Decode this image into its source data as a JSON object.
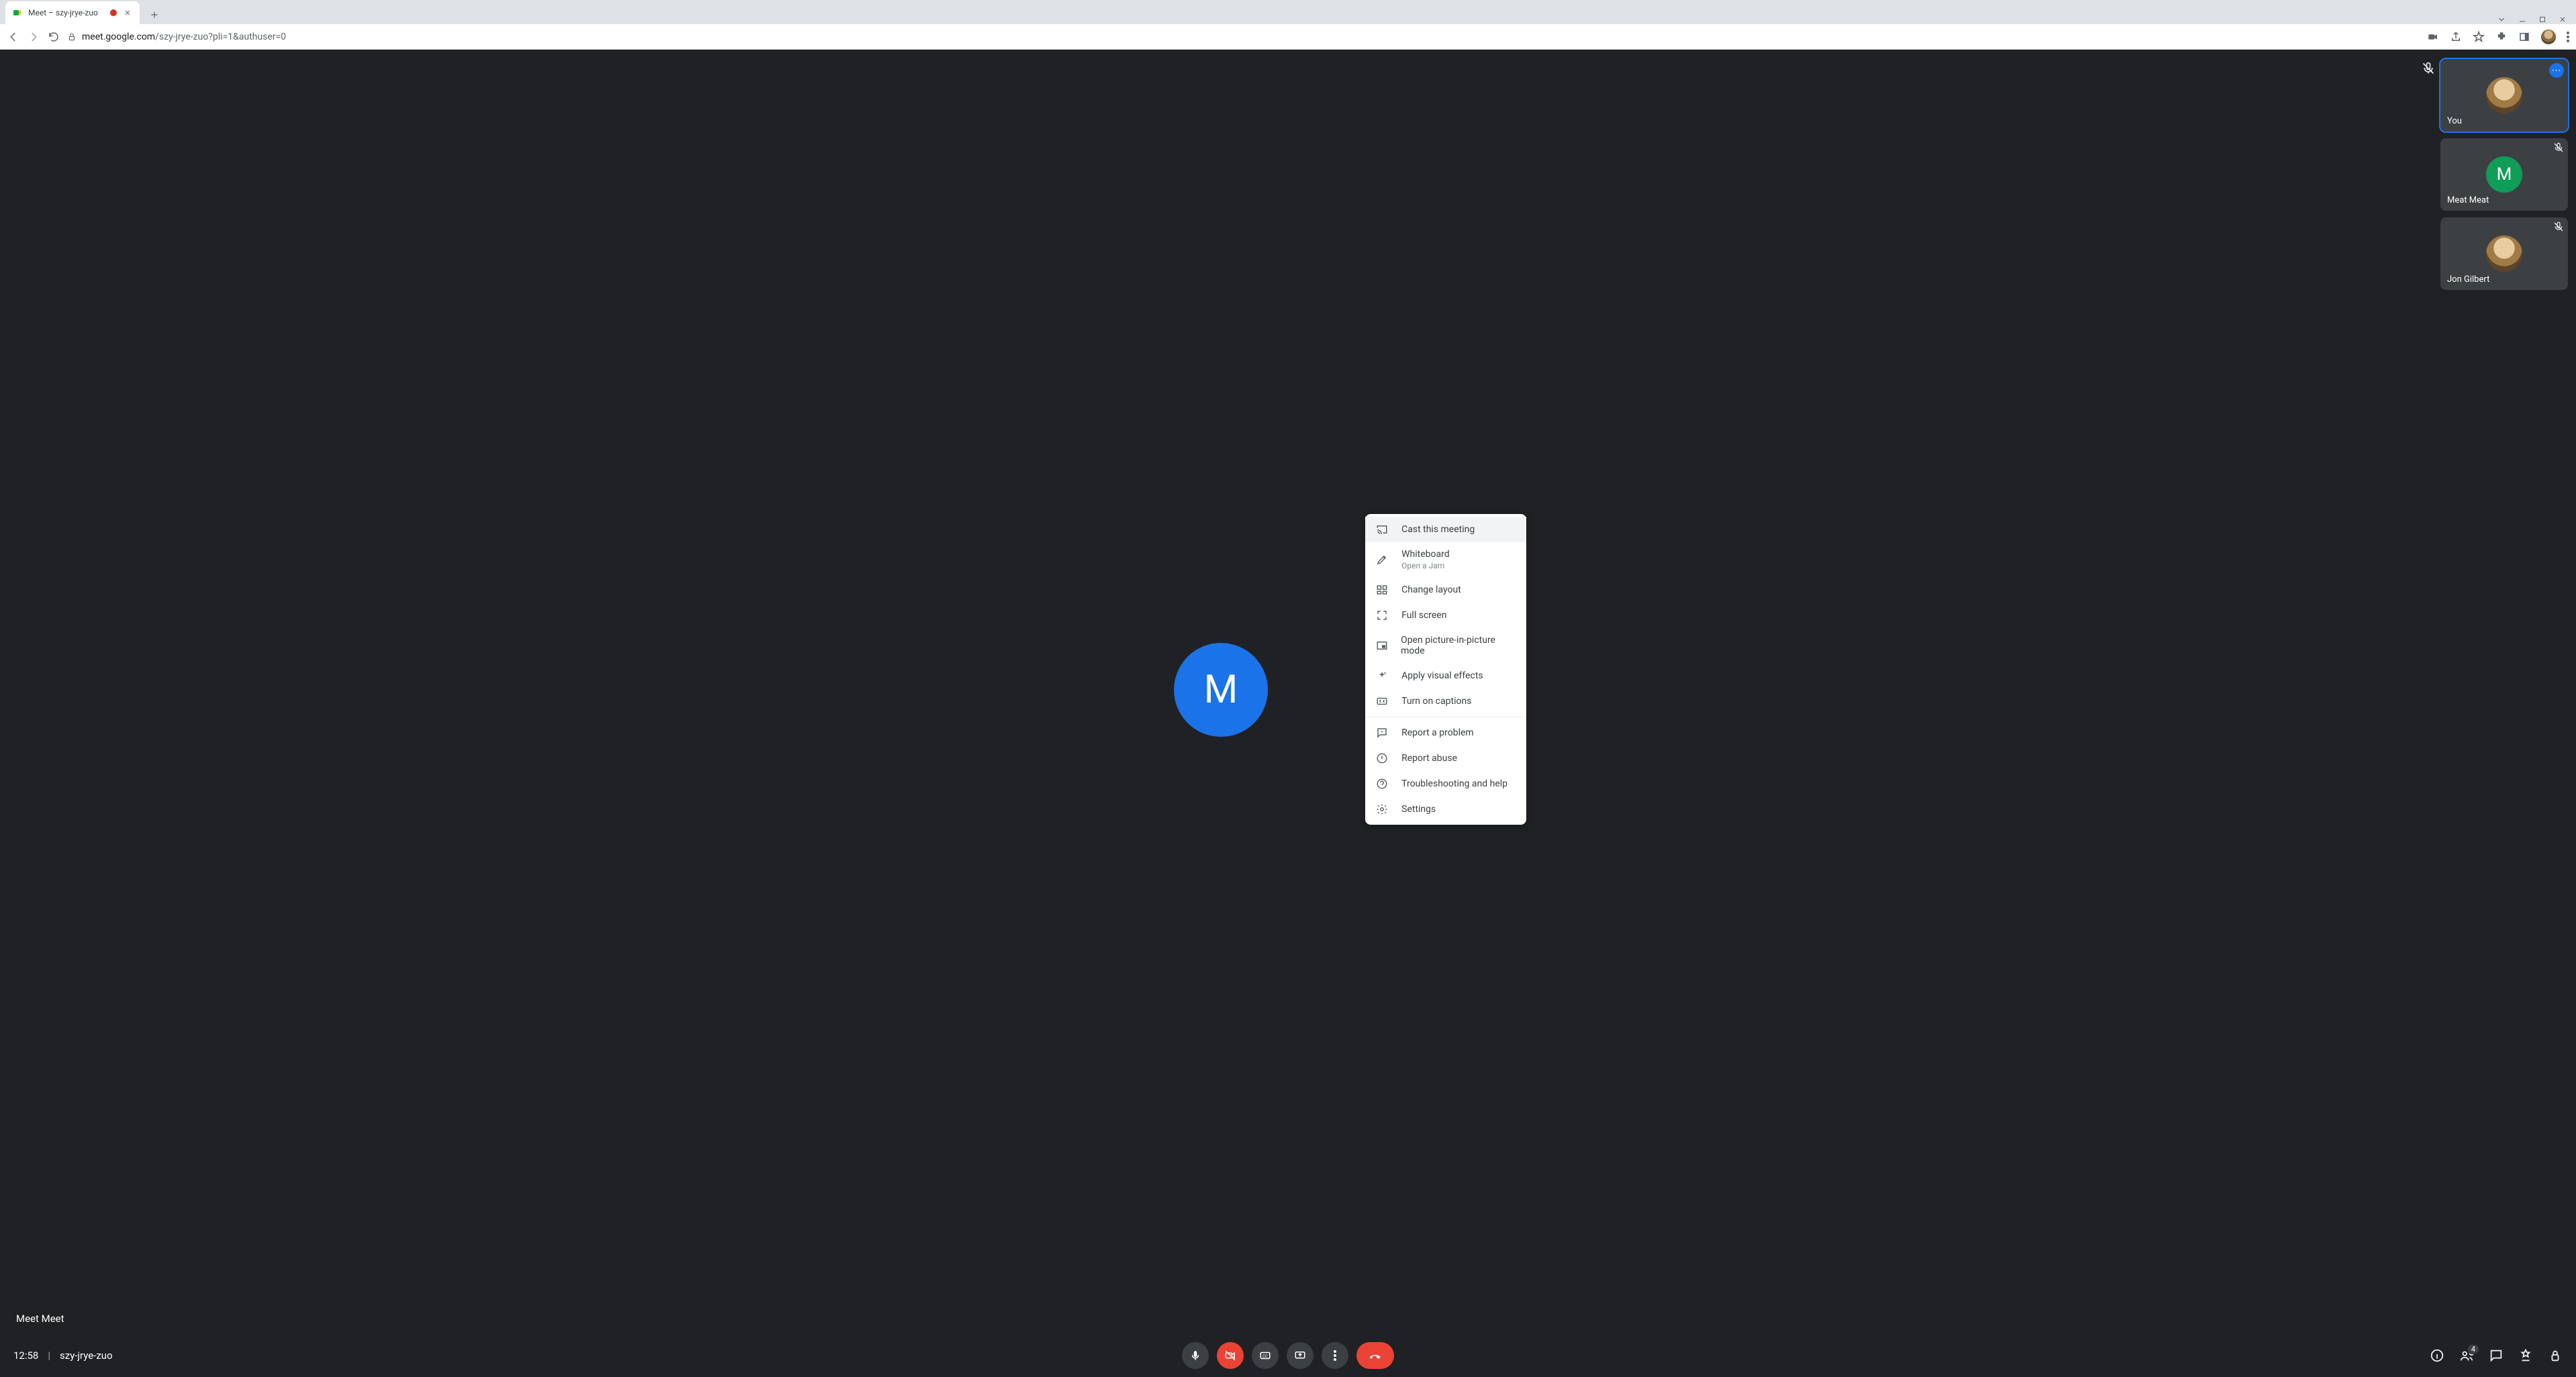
{
  "browser": {
    "tab_title": "Meet – szy-jrye-zuo",
    "url_host": "meet.google.com",
    "url_path": "/szy-jrye-zuo?pli=1&authuser=0"
  },
  "main_speaker": {
    "initial": "M",
    "name": "Meet Meet"
  },
  "self_muted_indicator": true,
  "participants": [
    {
      "name": "You",
      "avatar": "photo",
      "active": true,
      "corner": "more"
    },
    {
      "name": "Meat Meat",
      "avatar": "green",
      "initial": "M",
      "active": false,
      "corner": "muted"
    },
    {
      "name": "Jon Gilbert",
      "avatar": "photo",
      "active": false,
      "corner": "muted"
    }
  ],
  "menu": {
    "section1": [
      {
        "icon": "cast",
        "label": "Cast this meeting",
        "hover": true
      },
      {
        "icon": "pencil",
        "label": "Whiteboard",
        "sub": "Open a Jam"
      },
      {
        "icon": "layout",
        "label": "Change layout"
      },
      {
        "icon": "fullscreen",
        "label": "Full screen"
      },
      {
        "icon": "pip",
        "label": "Open picture-in-picture mode"
      },
      {
        "icon": "sparkle",
        "label": "Apply visual effects"
      },
      {
        "icon": "cc",
        "label": "Turn on captions"
      }
    ],
    "section2": [
      {
        "icon": "report",
        "label": "Report a problem"
      },
      {
        "icon": "abuse",
        "label": "Report abuse"
      },
      {
        "icon": "help",
        "label": "Troubleshooting and help"
      },
      {
        "icon": "gear",
        "label": "Settings"
      }
    ]
  },
  "bottom": {
    "time": "12:58",
    "code": "szy-jrye-zuo",
    "participant_count": "4"
  }
}
